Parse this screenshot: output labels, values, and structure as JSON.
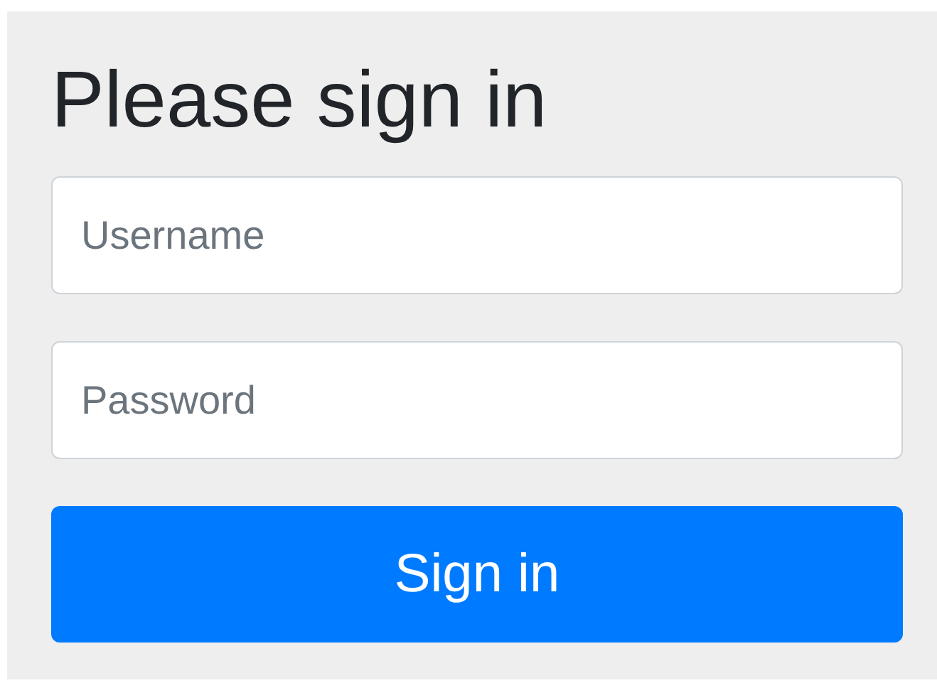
{
  "heading": "Please sign in",
  "fields": [
    {
      "placeholder": "Username"
    },
    {
      "placeholder": "Password"
    }
  ],
  "submit_button": "Sign in"
}
